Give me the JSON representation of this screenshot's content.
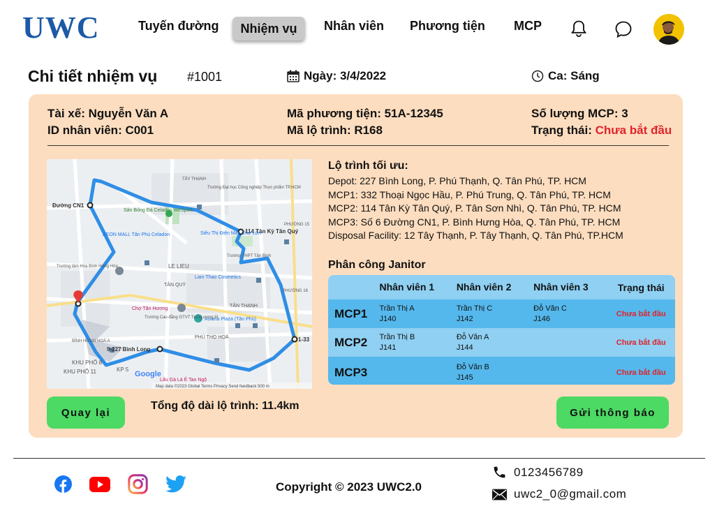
{
  "brand": {
    "logo_text": "UWC"
  },
  "nav": {
    "items": [
      "Tuyến đường",
      "Nhiệm vụ",
      "Nhân viên",
      "Phương tiện",
      "MCP"
    ],
    "active": "Nhiệm vụ"
  },
  "page": {
    "title": "Chi tiết nhiệm vụ",
    "task_id": "#1001",
    "date": "Ngày: 3/4/2022",
    "shift": "Ca: Sáng"
  },
  "details": {
    "driver": "Tài xế: Nguyễn Văn A",
    "staff_id": "ID nhân viên: C001",
    "vehicle": "Mã phương tiện: 51A-12345",
    "route_code": "Mã lộ trình: R168",
    "mcp_count": "Số lượng MCP: 3",
    "status_label": "Trạng thái: ",
    "status_value": "Chưa bắt đầu"
  },
  "map": {
    "labels": [
      "Đường CN1",
      "114 Tân Kỳ Tân Quý",
      "9-227 Bình Long",
      "1-33",
      "LE LIEU",
      "TÂN QUÝ",
      "TÂN THẠNH",
      "PHÚ THỌ HOÀ",
      "BÌNH HƯNG HOÀ A",
      "KHU PHỐ 8",
      "KHU PHỐ 11",
      "KP 5",
      "AEON MALL Tân Phú Celadon",
      "Sân Bóng Đá Celadon WeSport",
      "Trường Đại học Công nghiệp Thực phẩm TP.HCM",
      "Siêu Thị Điện Máy Chợ Lớn",
      "Lam Thao Cosmetics",
      "Chợ Tân Hương",
      "Asiana Plaza (Tân Phú)",
      "Trường tâm Hóa Bình Hưng Hòa",
      "Trường THPT Tân Bình",
      "Trường Cao đẳng GTVT Trung ương III",
      "Lẩu Gà Lá É Tao Ngộ",
      "PHƯỜNG 16",
      "PHƯỜNG 15",
      "TÂY THẠNH",
      "Google",
      "Map data ©2023   Global   Terms   Privacy   Send feedback   500 m"
    ]
  },
  "route": {
    "title": "Lộ trình tối ưu:",
    "lines": [
      "Depot: 227 Bình Long, P. Phú Thạnh, Q. Tân Phú, TP. HCM",
      "MCP1: 332 Thoại Ngọc Hầu, P. Phú Trung, Q. Tân Phú, TP. HCM",
      "MCP2: 114 Tân Kỳ Tân Quý, P. Tân Sơn Nhì, Q. Tân Phú, TP. HCM",
      "MCP3: Số 6 Đường CN1, P. Bình Hưng Hòa, Q. Tân Phú, TP. HCM",
      "Disposal Facility: 12 Tây Thạnh, P. Tây Thạnh, Q. Tân Phú, TP.HCM"
    ]
  },
  "assignment": {
    "title": "Phân công Janitor",
    "headers": [
      "",
      "Nhân viên 1",
      "Nhân viên 2",
      "Nhân viên 3",
      "Trạng thái"
    ],
    "rows": [
      {
        "mcp": "MCP1",
        "w1": "Trần Thị A",
        "w1_id": "J140",
        "w2": "Trần Thị C",
        "w2_id": "J142",
        "w3": "Đỗ Văn C",
        "w3_id": "J146",
        "status": "Chưa bắt đầu"
      },
      {
        "mcp": "MCP2",
        "w1": "Trần Thị B",
        "w1_id": "J141",
        "w2": "Đỗ Văn A",
        "w2_id": "J144",
        "w3": "",
        "w3_id": "",
        "status": "Chưa bắt đầu"
      },
      {
        "mcp": "MCP3",
        "w1": "",
        "w1_id": "",
        "w2": "Đỗ Văn B",
        "w2_id": "J145",
        "w3": "",
        "w3_id": "",
        "status": "Chưa bắt đầu"
      }
    ]
  },
  "actions": {
    "back": "Quay lại",
    "total_length": "Tổng độ dài lộ trình: 11.4km",
    "send": "Gửi thông báo"
  },
  "footer": {
    "copyright": "Copyright ©  2023 UWC2.0",
    "phone": "0123456789",
    "email": "uwc2_0@gmail.com",
    "social_icons": [
      "facebook-icon",
      "youtube-icon",
      "instagram-icon",
      "twitter-icon"
    ]
  },
  "colors": {
    "brand": "#1d5aa6",
    "card_bg": "#fdddbf",
    "status_red": "#e0242c",
    "button_green": "#4cd964",
    "table_blue": "#8fd0f3",
    "table_row_dark": "#55b8ec",
    "route_blue": "#2f8ee6"
  }
}
